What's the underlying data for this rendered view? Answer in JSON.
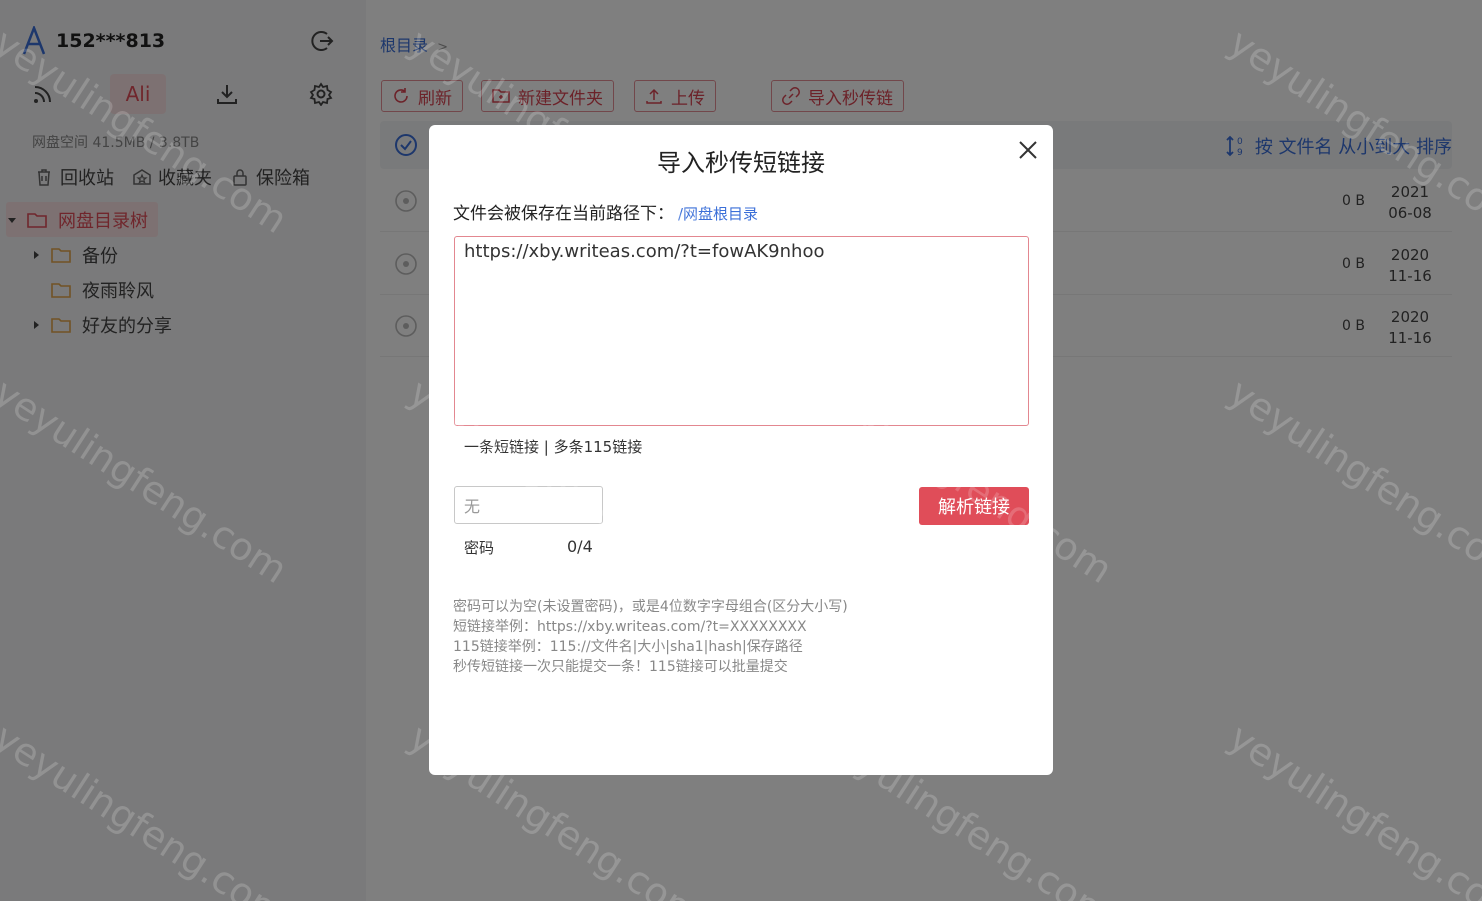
{
  "sidebar": {
    "user": {
      "name": "152***813",
      "logo_letter": "A"
    },
    "tools": {
      "ali_label": "Ali"
    },
    "space": "网盘空间 41.5MB / 3.8TB",
    "quick": [
      {
        "label": "回收站",
        "icon": "trash-icon"
      },
      {
        "label": "收藏夹",
        "icon": "star-box-icon"
      },
      {
        "label": "保险箱",
        "icon": "lock-icon"
      }
    ],
    "tree": {
      "root": "网盘目录树",
      "children": [
        "备份",
        "夜雨聆风",
        "好友的分享"
      ]
    }
  },
  "main": {
    "breadcrumb": {
      "root": "根目录",
      "sep": ">"
    },
    "toolbar": {
      "refresh": "刷新",
      "new_folder": "新建文件夹",
      "upload": "上传",
      "import": "导入秒传链"
    },
    "sort": "按 文件名 从小到大 排序",
    "files": [
      {
        "size": "0 B",
        "year": "2021",
        "md": "06-08"
      },
      {
        "size": "0 B",
        "year": "2020",
        "md": "11-16"
      },
      {
        "size": "0 B",
        "year": "2020",
        "md": "11-16"
      }
    ]
  },
  "modal": {
    "title": "导入秒传短链接",
    "save_path_label": "文件会被保存在当前路径下：",
    "save_path_link": "/网盘根目录",
    "link_value": "https://xby.writeas.com/?t=fowAK9nhoo",
    "link_hint": "一条短链接 | 多条115链接",
    "password_placeholder": "无",
    "password_label": "密码",
    "password_count": "0/4",
    "parse_button": "解析链接",
    "notes": [
      "密码可以为空(未设置密码)，或是4位数字字母组合(区分大小写)",
      "短链接举例：https://xby.writeas.com/?t=XXXXXXXX",
      "115链接举例：115://文件名|大小|sha1|hash|保存路径",
      "秒传短链接一次只能提交一条！115链接可以批量提交"
    ]
  },
  "watermark": "yeyulingfeng.com",
  "colors": {
    "accent": "#e04d59",
    "link": "#3b6fd8"
  }
}
